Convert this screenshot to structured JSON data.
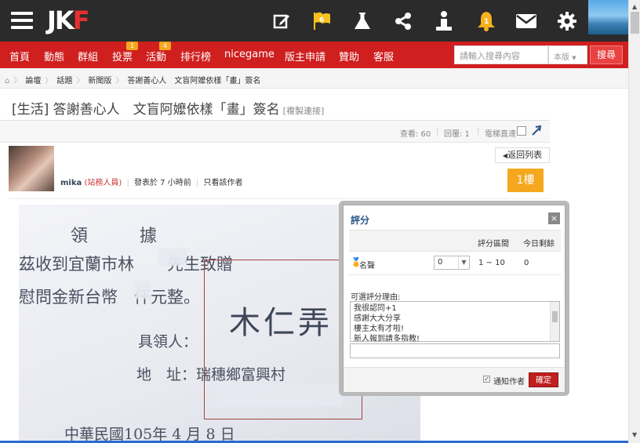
{
  "topbar": {
    "logo_part1": "JK",
    "logo_part2": "F",
    "icons": [
      "edit-icon",
      "flag-icon",
      "flask-icon",
      "share-icon",
      "user-info-icon",
      "bell-icon",
      "mail-icon",
      "gear-icon"
    ],
    "flag_badge": "6",
    "bell_badge": "1"
  },
  "nav": {
    "items": [
      "首頁",
      "動態",
      "群組",
      "投票",
      "活動",
      "排行榜",
      "nicegame",
      "版主申請",
      "贊助",
      "客服"
    ],
    "vote_badge": "1",
    "event_badge": "4",
    "search_placeholder": "請輸入搜尋內容",
    "search_scope": "本版",
    "search_button": "搜尋"
  },
  "breadcrumb": [
    "論壇",
    "話題",
    "新聞版",
    "答謝善心人　文盲阿嬤依樣「畫」簽名"
  ],
  "post": {
    "title": "[生活] 答謝善心人　文盲阿嬤依樣「畫」簽名",
    "copy_link": "[複製連接]",
    "views": "查看: 60",
    "replies": "回覆: 1",
    "elevator": "電梯直達",
    "back_to_list": "返回列表",
    "author": "mika",
    "author_role": "(站務人員)",
    "posted": "發表於 7 小時前",
    "only_author": "只看該作者",
    "floor": "1樓"
  },
  "note_text": {
    "line1": "領　據",
    "line2": "茲收到宜蘭市林　　先生致贈",
    "line3": "慰問金新台幣　仟元整。",
    "line4": "具領人：",
    "line5": "地　址：瑞穗鄉富興村",
    "line6": "中華民國105年 4 月 8 日",
    "signature": "木仁弄"
  },
  "modal": {
    "title": "評分",
    "close": "×",
    "col_range": "評分區間",
    "col_remaining": "今日剩餘",
    "row_label": "名聲",
    "select_value": "0",
    "range": "1 ~ 10",
    "remaining": "0",
    "reason_label": "可選評分理由:",
    "reasons": [
      "我很認同+1",
      "感謝大大分享",
      "樓主太有才啦!",
      "新人報到請多指教!"
    ],
    "notify_label": "通知作者",
    "confirm": "確定"
  },
  "colors": {
    "topbar": "#2b2b2b",
    "nav": "#d01f1f",
    "accent_orange": "#f5a81e",
    "confirm": "#c0201f"
  }
}
